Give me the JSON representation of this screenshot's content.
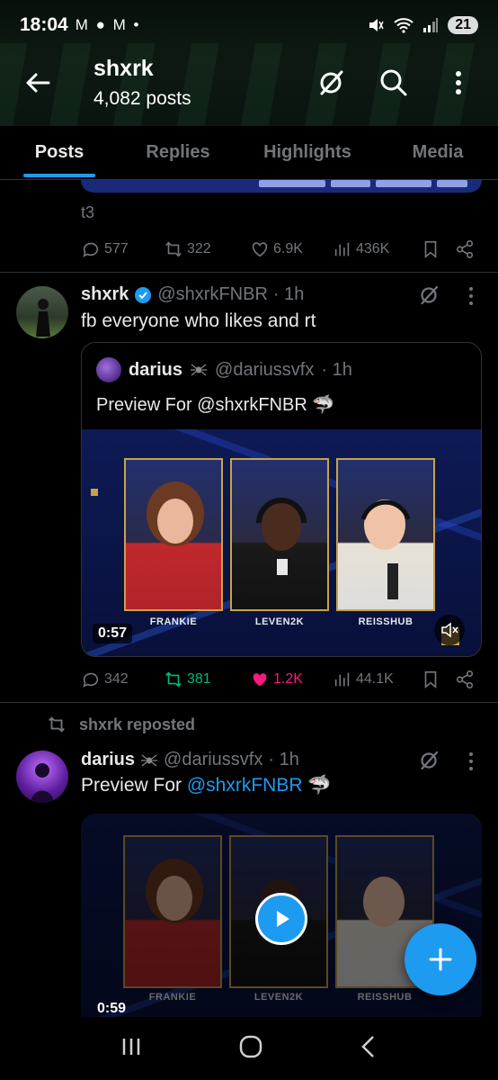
{
  "status": {
    "time": "18:04",
    "left_icons": "M ● M •",
    "battery": "21"
  },
  "header": {
    "name": "shxrk",
    "post_count": "4,082 posts"
  },
  "tabs": [
    {
      "label": "Posts"
    },
    {
      "label": "Replies"
    },
    {
      "label": "Highlights"
    },
    {
      "label": "Media"
    }
  ],
  "prev_post": {
    "text": "t3",
    "replies": "577",
    "reposts": "322",
    "likes": "6.9K",
    "views": "436K"
  },
  "post1": {
    "name": "shxrk",
    "handle": "@shxrkFNBR",
    "time": "· 1h",
    "text": "fb everyone who likes and rt",
    "quote": {
      "name": "darius",
      "handle": "@dariussvfx",
      "time": "· 1h",
      "text": "Preview For @shxrkFNBR",
      "shark": "🦈",
      "cams": [
        "FRANKIE",
        "LEVEN2K",
        "REISSHUB"
      ],
      "duration": "0:57"
    },
    "replies": "342",
    "reposts": "381",
    "likes": "1.2K",
    "views": "44.1K"
  },
  "post2": {
    "repost_label": "shxrk reposted",
    "name": "darius",
    "handle": "@dariussvfx",
    "time": "· 1h",
    "text_prefix": "Preview For ",
    "mention": "@shxrkFNBR",
    "shark": "🦈",
    "cams": [
      "FRANKIE",
      "LEVEN2K",
      "REISSHUB"
    ],
    "duration": "0:59"
  },
  "colors": {
    "accent": "#1d9bf0",
    "like": "#f91880",
    "repost": "#00ba7c",
    "muted": "#71767b"
  }
}
